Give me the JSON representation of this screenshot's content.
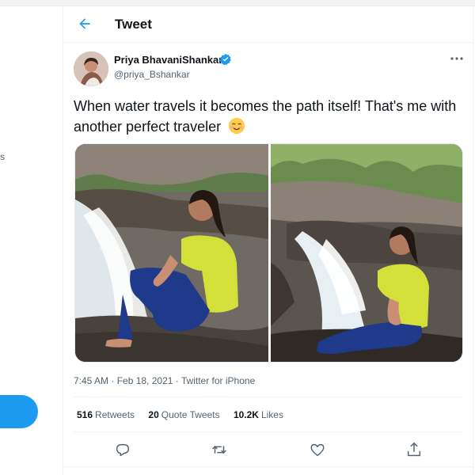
{
  "sidebar": {
    "fragment_text": "s"
  },
  "header": {
    "title": "Tweet",
    "back_icon": "arrow-left-icon"
  },
  "tweet": {
    "author": {
      "name": "Priya BhavaniShankar",
      "handle": "@priya_Bshankar",
      "verified": true
    },
    "text": "When water travels it becomes the path itself! That's me with another perfect traveler",
    "emoji": "smiling-face-with-blush",
    "meta": "7:45 AM · Feb 18, 2021 · Twitter for iPhone",
    "stats": {
      "retweets_count": "516",
      "retweets_label": "Retweets",
      "quotes_count": "20",
      "quotes_label": "Quote Tweets",
      "likes_count": "10.2K",
      "likes_label": "Likes"
    },
    "actions": [
      "reply-icon",
      "retweet-icon",
      "like-icon",
      "share-icon"
    ]
  },
  "colors": {
    "accent": "#1d9bf0",
    "text_primary": "#0f1419",
    "text_secondary": "#536471",
    "shirt": "#d4e03a",
    "pants": "#1f3a8a"
  }
}
